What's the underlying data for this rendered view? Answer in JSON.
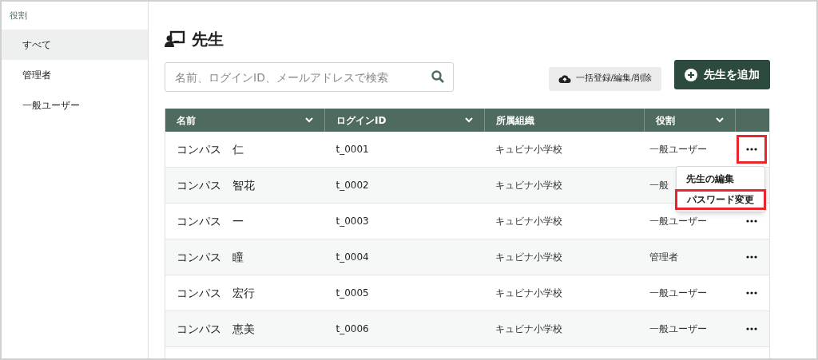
{
  "sidebar": {
    "heading": "役割",
    "items": [
      {
        "label": "すべて",
        "selected": true
      },
      {
        "label": "管理者",
        "selected": false
      },
      {
        "label": "一般ユーザー",
        "selected": false
      }
    ]
  },
  "page": {
    "title": "先生"
  },
  "search": {
    "placeholder": "名前、ログインID、メールアドレスで検索"
  },
  "buttons": {
    "bulk": "一括登録/編集/削除",
    "add": "先生を追加"
  },
  "table": {
    "columns": [
      {
        "label": "名前",
        "sortable": true
      },
      {
        "label": "ログインID",
        "sortable": true
      },
      {
        "label": "所属組織",
        "sortable": false
      },
      {
        "label": "役割",
        "sortable": true
      }
    ],
    "rows": [
      {
        "name": "コンパス　仁",
        "login_id": "t_0001",
        "org": "キュビナ小学校",
        "role": "一般ユーザー",
        "highlighted": true
      },
      {
        "name": "コンパス　智花",
        "login_id": "t_0002",
        "org": "キュビナ小学校",
        "role": "一般",
        "highlighted": false
      },
      {
        "name": "コンパス　一",
        "login_id": "t_0003",
        "org": "キュビナ小学校",
        "role": "一般ユーザー",
        "highlighted": false
      },
      {
        "name": "コンパス　瞳",
        "login_id": "t_0004",
        "org": "キュビナ小学校",
        "role": "管理者",
        "highlighted": false
      },
      {
        "name": "コンパス　宏行",
        "login_id": "t_0005",
        "org": "キュビナ小学校",
        "role": "一般ユーザー",
        "highlighted": false
      },
      {
        "name": "コンパス　恵美",
        "login_id": "t_0006",
        "org": "キュビナ小学校",
        "role": "一般ユーザー",
        "highlighted": false
      }
    ]
  },
  "menu": {
    "items": [
      {
        "label": "先生の編集",
        "highlighted": false
      },
      {
        "label": "パスワード変更",
        "highlighted": true
      }
    ]
  }
}
